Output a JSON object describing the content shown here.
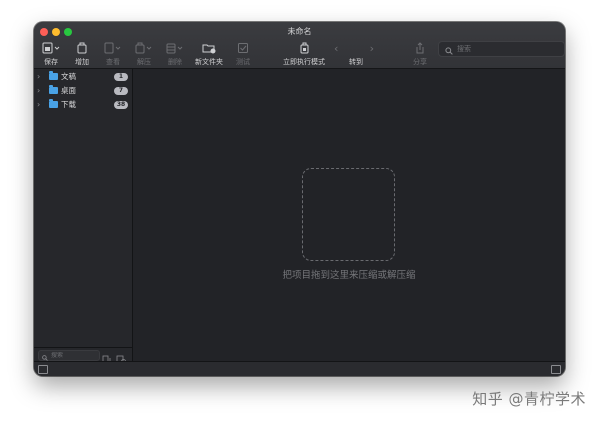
{
  "window": {
    "title": "未命名"
  },
  "toolbar": {
    "items": [
      {
        "label": "保存",
        "icon": "save-icon",
        "enabled": true
      },
      {
        "label": "增加",
        "icon": "add-icon",
        "enabled": true
      },
      {
        "label": "查看",
        "icon": "view-icon",
        "enabled": false
      },
      {
        "label": "解压",
        "icon": "extract-icon",
        "enabled": false
      },
      {
        "label": "删除",
        "icon": "delete-icon",
        "enabled": false
      },
      {
        "label": "新文件夹",
        "icon": "new-folder-icon",
        "enabled": true
      },
      {
        "label": "测试",
        "icon": "test-icon",
        "enabled": false
      },
      {
        "label": "立即执行模式",
        "icon": "instant-mode-icon",
        "enabled": true
      },
      {
        "label": "转到",
        "icon": "goto-icon",
        "enabled": true
      },
      {
        "label": "分享",
        "icon": "share-icon",
        "enabled": false
      }
    ],
    "search_placeholder": "搜索"
  },
  "sidebar": {
    "items": [
      {
        "name": "文稿",
        "count": "1"
      },
      {
        "name": "桌面",
        "count": "7"
      },
      {
        "name": "下载",
        "count": "38"
      }
    ],
    "search_placeholder": "搜索"
  },
  "main": {
    "drop_hint": "把项目拖到这里来压缩或解压缩"
  },
  "watermark": "知乎 @青柠学术",
  "colors": {
    "folder": "#49a2e6",
    "window_bg": "#232428",
    "toolbar_bg": "#3b3c40"
  }
}
